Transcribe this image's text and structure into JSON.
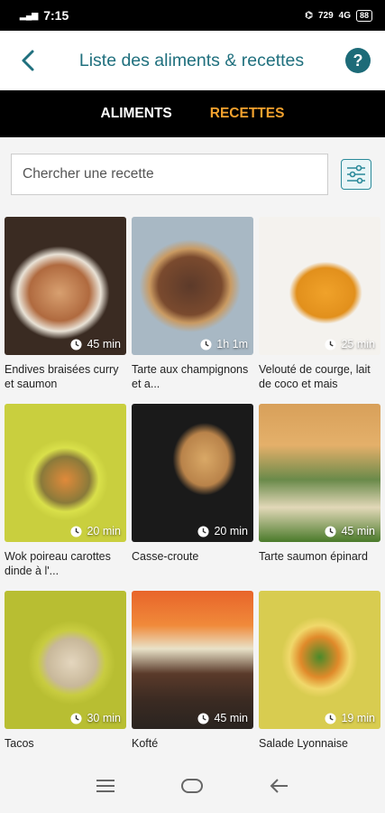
{
  "status_bar": {
    "time": "7:15",
    "speed": "729\nK/S",
    "battery": "88"
  },
  "header": {
    "title": "Liste des aliments & recettes"
  },
  "tabs": [
    {
      "label": "ALIMENTS"
    },
    {
      "label": "RECETTES"
    }
  ],
  "search": {
    "placeholder": "Chercher une recette"
  },
  "recipes": [
    {
      "title": "Endives braisées curry et saumon",
      "duration": "45 min"
    },
    {
      "title": "Tarte aux champignons et a...",
      "duration": "1h 1m"
    },
    {
      "title": "Velouté de courge, lait de coco et mais",
      "duration": "25 min"
    },
    {
      "title": "Wok poireau carottes dinde à l'...",
      "duration": "20 min"
    },
    {
      "title": "Casse-croute",
      "duration": "20 min"
    },
    {
      "title": "Tarte saumon épinard",
      "duration": "45 min"
    },
    {
      "title": "Tacos",
      "duration": "30 min"
    },
    {
      "title": "Kofté",
      "duration": "45 min"
    },
    {
      "title": "Salade Lyonnaise",
      "duration": "19 min"
    }
  ],
  "colors": {
    "accent": "#20707e",
    "active_tab": "#f3a22e"
  },
  "icons": [
    "back-arrow-icon",
    "help-icon",
    "filter-icon",
    "clock-icon",
    "menu-icon",
    "home-icon",
    "back-icon"
  ]
}
